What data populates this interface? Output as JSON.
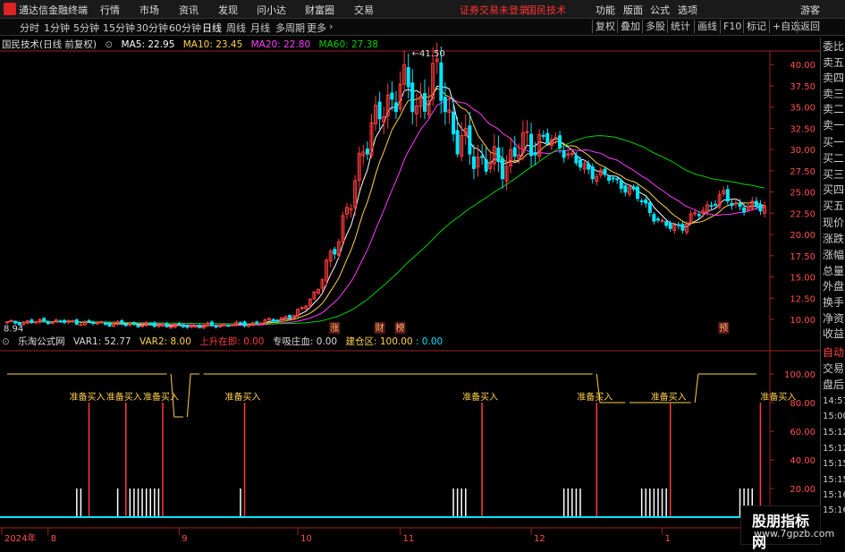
{
  "menubar": {
    "title": "通达信金融终端",
    "items": [
      "行情",
      "市场",
      "资讯",
      "发现",
      "问小达",
      "财富圈",
      "交易"
    ],
    "status_red": [
      "证券交易未登录",
      "国民技术"
    ],
    "right_items": [
      "功能",
      "版面",
      "公式",
      "选项"
    ],
    "guest": "游客"
  },
  "periods": {
    "items": [
      "分时",
      "1分钟",
      "5分钟",
      "15分钟",
      "30分钟",
      "60分钟",
      "日线",
      "周线",
      "月线",
      "多周期",
      "更多"
    ],
    "active": "日线"
  },
  "toolbar_right": [
    "复权",
    "叠加",
    "多股",
    "统计",
    "画线",
    "F10",
    "标记",
    "+自选",
    "返回"
  ],
  "main_info": {
    "stock": "国民技术(日线 前复权)",
    "ma5": "MA5: 22.95",
    "ma10": "MA10: 23.45",
    "ma20": "MA20: 22.80",
    "ma60": "MA60: 27.38"
  },
  "sub_info": {
    "name": "乐淘公式网",
    "var1": "VAR1: 52.77",
    "var2": "VAR2: 8.00",
    "up_label": "上升在即: 0.00",
    "zhuang_label": "专吸庄血: 0.00",
    "jian_label": "建仓区: 100.00",
    "jian_extra": ": 0.00"
  },
  "sidebar": {
    "items": [
      "委比",
      "卖五",
      "卖四",
      "卖三",
      "卖二",
      "卖一",
      "买一",
      "买二",
      "买三",
      "买四",
      "买五",
      "现价",
      "涨跌",
      "涨幅",
      "总量",
      "外盘",
      "换手",
      "净资",
      "收益"
    ],
    "bottom": [
      "自动",
      "交易",
      "盘后",
      "14:57",
      "15:00",
      "15:12",
      "15:12",
      "15:15",
      "15:15",
      "15:16",
      "15:16"
    ]
  },
  "watermark": {
    "line1": "股朋指标网",
    "line2": "www.7gpzb.com"
  },
  "colors": {
    "up": "#ff3b3b",
    "down": "#00e5ff",
    "ma5": "#ffffff",
    "ma10": "#ffd24a",
    "ma20": "#ff3cff",
    "ma60": "#00d000",
    "axis": "#c03030",
    "signal": "#ffd24a"
  },
  "chart_data": {
    "type": "candlestick",
    "ylim": [
      8.0,
      41.5
    ],
    "yticks": [
      "10.00",
      "12.50",
      "15.00",
      "17.50",
      "20.00",
      "22.50",
      "25.00",
      "27.50",
      "30.00",
      "32.50",
      "35.00",
      "37.50",
      "40.00"
    ],
    "max_label": "41.50",
    "min_label": "8.94",
    "events": [
      {
        "i": 80,
        "text": "涨"
      },
      {
        "i": 91,
        "text": "财"
      },
      {
        "i": 96,
        "text": "榜"
      },
      {
        "i": 175,
        "text": "预"
      }
    ],
    "x_labels": [
      {
        "i": 0,
        "text": "2024年"
      },
      {
        "i": 10,
        "text": "8"
      },
      {
        "i": 42,
        "text": "9"
      },
      {
        "i": 71,
        "text": "10"
      },
      {
        "i": 96,
        "text": "11"
      },
      {
        "i": 128,
        "text": "12"
      },
      {
        "i": 160,
        "text": "1"
      }
    ],
    "indicator": {
      "ylim": [
        0,
        115
      ],
      "yticks": [
        "20.00",
        "40.00",
        "60.00",
        "80.00",
        "100.00"
      ],
      "line_levels": [
        [
          0,
          39,
          100
        ],
        [
          40,
          43,
          70
        ],
        [
          44,
          47,
          100
        ],
        [
          48,
          143,
          100
        ],
        [
          144,
          151,
          80
        ],
        [
          152,
          167,
          80
        ],
        [
          168,
          183,
          100
        ]
      ],
      "signals": [
        {
          "i": 20,
          "text": "准备买入"
        },
        {
          "i": 29,
          "text": "准备买入"
        },
        {
          "i": 38,
          "text": "准备买入"
        },
        {
          "i": 58,
          "text": "准备买入"
        },
        {
          "i": 116,
          "text": "准备买入"
        },
        {
          "i": 144,
          "text": "准备买入"
        },
        {
          "i": 162,
          "text": "准备买入"
        },
        {
          "i": 184,
          "text": "准备买入"
        }
      ],
      "bars": [
        17,
        18,
        27,
        30,
        31,
        32,
        33,
        34,
        35,
        36,
        37,
        57,
        109,
        110,
        111,
        112,
        136,
        137,
        138,
        139,
        140,
        155,
        156,
        157,
        158,
        159,
        160,
        161,
        179,
        180,
        181,
        182
      ]
    }
  }
}
